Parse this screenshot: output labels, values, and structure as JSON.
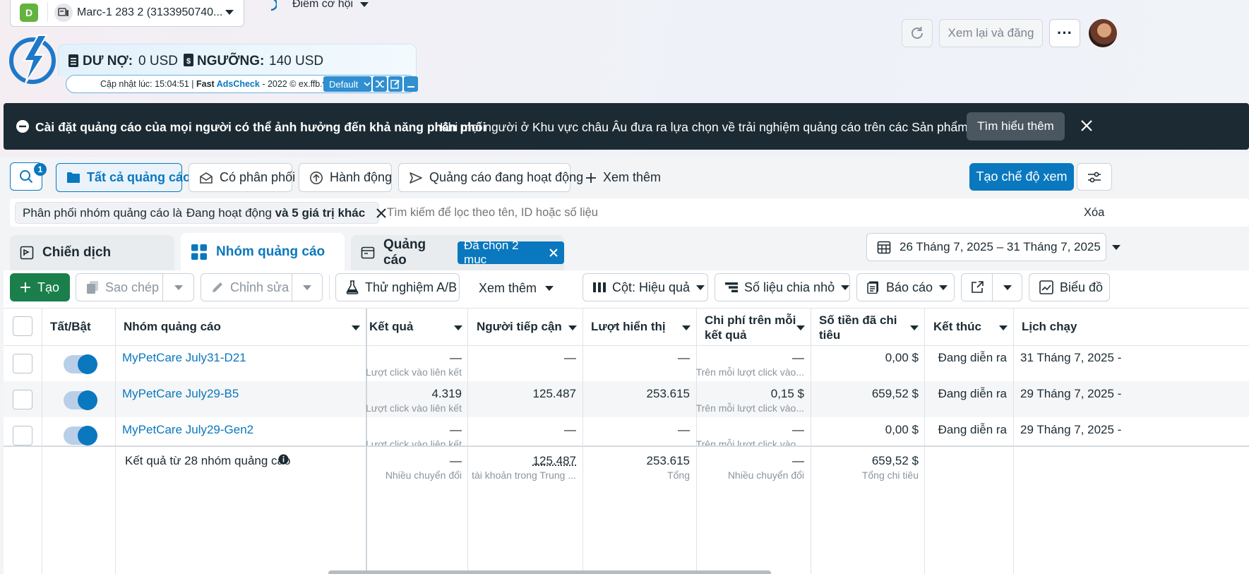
{
  "account": {
    "badge": "D",
    "name": "Marc-1 283 2 (3133950740..."
  },
  "opportunity": {
    "label": "Điểm cơ hội"
  },
  "topright": {
    "review_label": "Xem lại và đăng",
    "more": "···"
  },
  "ext": {
    "debt_label": "DƯ NỢ:",
    "debt_value": "0 USD",
    "threshold_label": "NGƯỠNG:",
    "threshold_value": "140 USD",
    "update_text": "Cập nhật lúc: 15:04:51 | ",
    "fast": "Fast ",
    "adscheck": "AdsCheck",
    "copyright": " - 2022 © ex.ffb.vn",
    "mode": "Default"
  },
  "banner": {
    "title": "Cài đặt quảng cáo của mọi người có thể ảnh hưởng đến khả năng phân phối",
    "body": "Khi mọi người ở Khu vực châu Âu đưa ra lựa chọn về trải nghiệm quảng cáo trên các Sản phẩm của chún...",
    "learn_more": "Tìm hiểu thêm"
  },
  "filters": {
    "search_badge": "1",
    "all": "Tất cả quảng cáo",
    "delivery": "Có phân phối",
    "actions": "Hành động",
    "active": "Quảng cáo đang hoạt động",
    "more": "Xem thêm",
    "create_view": "Tạo chế độ xem"
  },
  "filterbar": {
    "chip_prefix": "Phân phối nhóm quảng cáo là ",
    "chip_status": "Đang hoạt động",
    "chip_suffix": " và 5 giá trị khác",
    "search_placeholder": "Tìm kiếm để lọc theo tên, ID hoặc số liệu",
    "clear": "Xóa"
  },
  "tabs": {
    "campaign": "Chiến dịch",
    "adset": "Nhóm quảng cáo",
    "ads": "Quảng cáo",
    "selected": "Đã chọn 2 mục"
  },
  "daterange": "26 Tháng 7, 2025 – 31 Tháng 7, 2025",
  "toolbar": {
    "create": "Tạo",
    "copy": "Sao chép",
    "edit": "Chỉnh sửa",
    "ab": "Thử nghiệm A/B",
    "more": "Xem thêm",
    "columns": "Cột: Hiệu quả",
    "breakdown": "Số liệu chia nhỏ",
    "reports": "Báo cáo",
    "chart": "Biểu đồ"
  },
  "table": {
    "headers": {
      "toggle": "Tất/Bật",
      "name": "Nhóm quảng cáo",
      "results": "Kết quả",
      "reach": "Người tiếp cận",
      "impressions": "Lượt hiển thị",
      "cpr_1": "Chi phí trên mỗi",
      "cpr_2": "kết quả",
      "spent_1": "Số tiền đã chi",
      "spent_2": "tiêu",
      "ends": "Kết thúc",
      "schedule": "Lịch chạy"
    },
    "rows": [
      {
        "name": "MyPetCare July31-D21",
        "results": "—",
        "results_sub": "Lượt click vào liên kết",
        "reach": "—",
        "impressions": "—",
        "cpr": "—",
        "cpr_sub": "Trên mỗi lượt click vào...",
        "spent": "0,00 $",
        "ends": "Đang diễn ra",
        "schedule": "31 Tháng 7, 2025 -"
      },
      {
        "name": "MyPetCare July29-B5",
        "results": "4.319",
        "results_sub": "Lượt click vào liên kết",
        "reach": "125.487",
        "impressions": "253.615",
        "cpr": "0,15 $",
        "cpr_sub": "Trên mỗi lượt click vào...",
        "spent": "659,52 $",
        "ends": "Đang diễn ra",
        "schedule": "29 Tháng 7, 2025 -"
      },
      {
        "name": "MyPetCare July29-Gen2",
        "results": "—",
        "results_sub": "Lượt click vào liên kết",
        "reach": "—",
        "impressions": "—",
        "cpr": "—",
        "cpr_sub": "Trên mỗi lượt click vào...",
        "spent": "0,00 $",
        "ends": "Đang diễn ra",
        "schedule": "29 Tháng 7, 2025 -"
      }
    ],
    "summary": {
      "label": "Kết quả từ 28 nhóm quảng cáo",
      "results": "—",
      "results_sub": "Nhiều chuyển đổi",
      "reach": "125.487",
      "reach_sub": "tài khoản trong Trung ...",
      "impressions": "253.615",
      "impressions_sub": "Tổng",
      "cpr": "—",
      "cpr_sub": "Nhiều chuyển đổi",
      "spent": "659,52 $",
      "spent_sub": "Tổng chi tiêu"
    }
  },
  "colors": {
    "primary": "#0a78be",
    "create": "#1a7f4b",
    "banner": "#1c2b33",
    "active_dot": "#1a9e4b"
  }
}
